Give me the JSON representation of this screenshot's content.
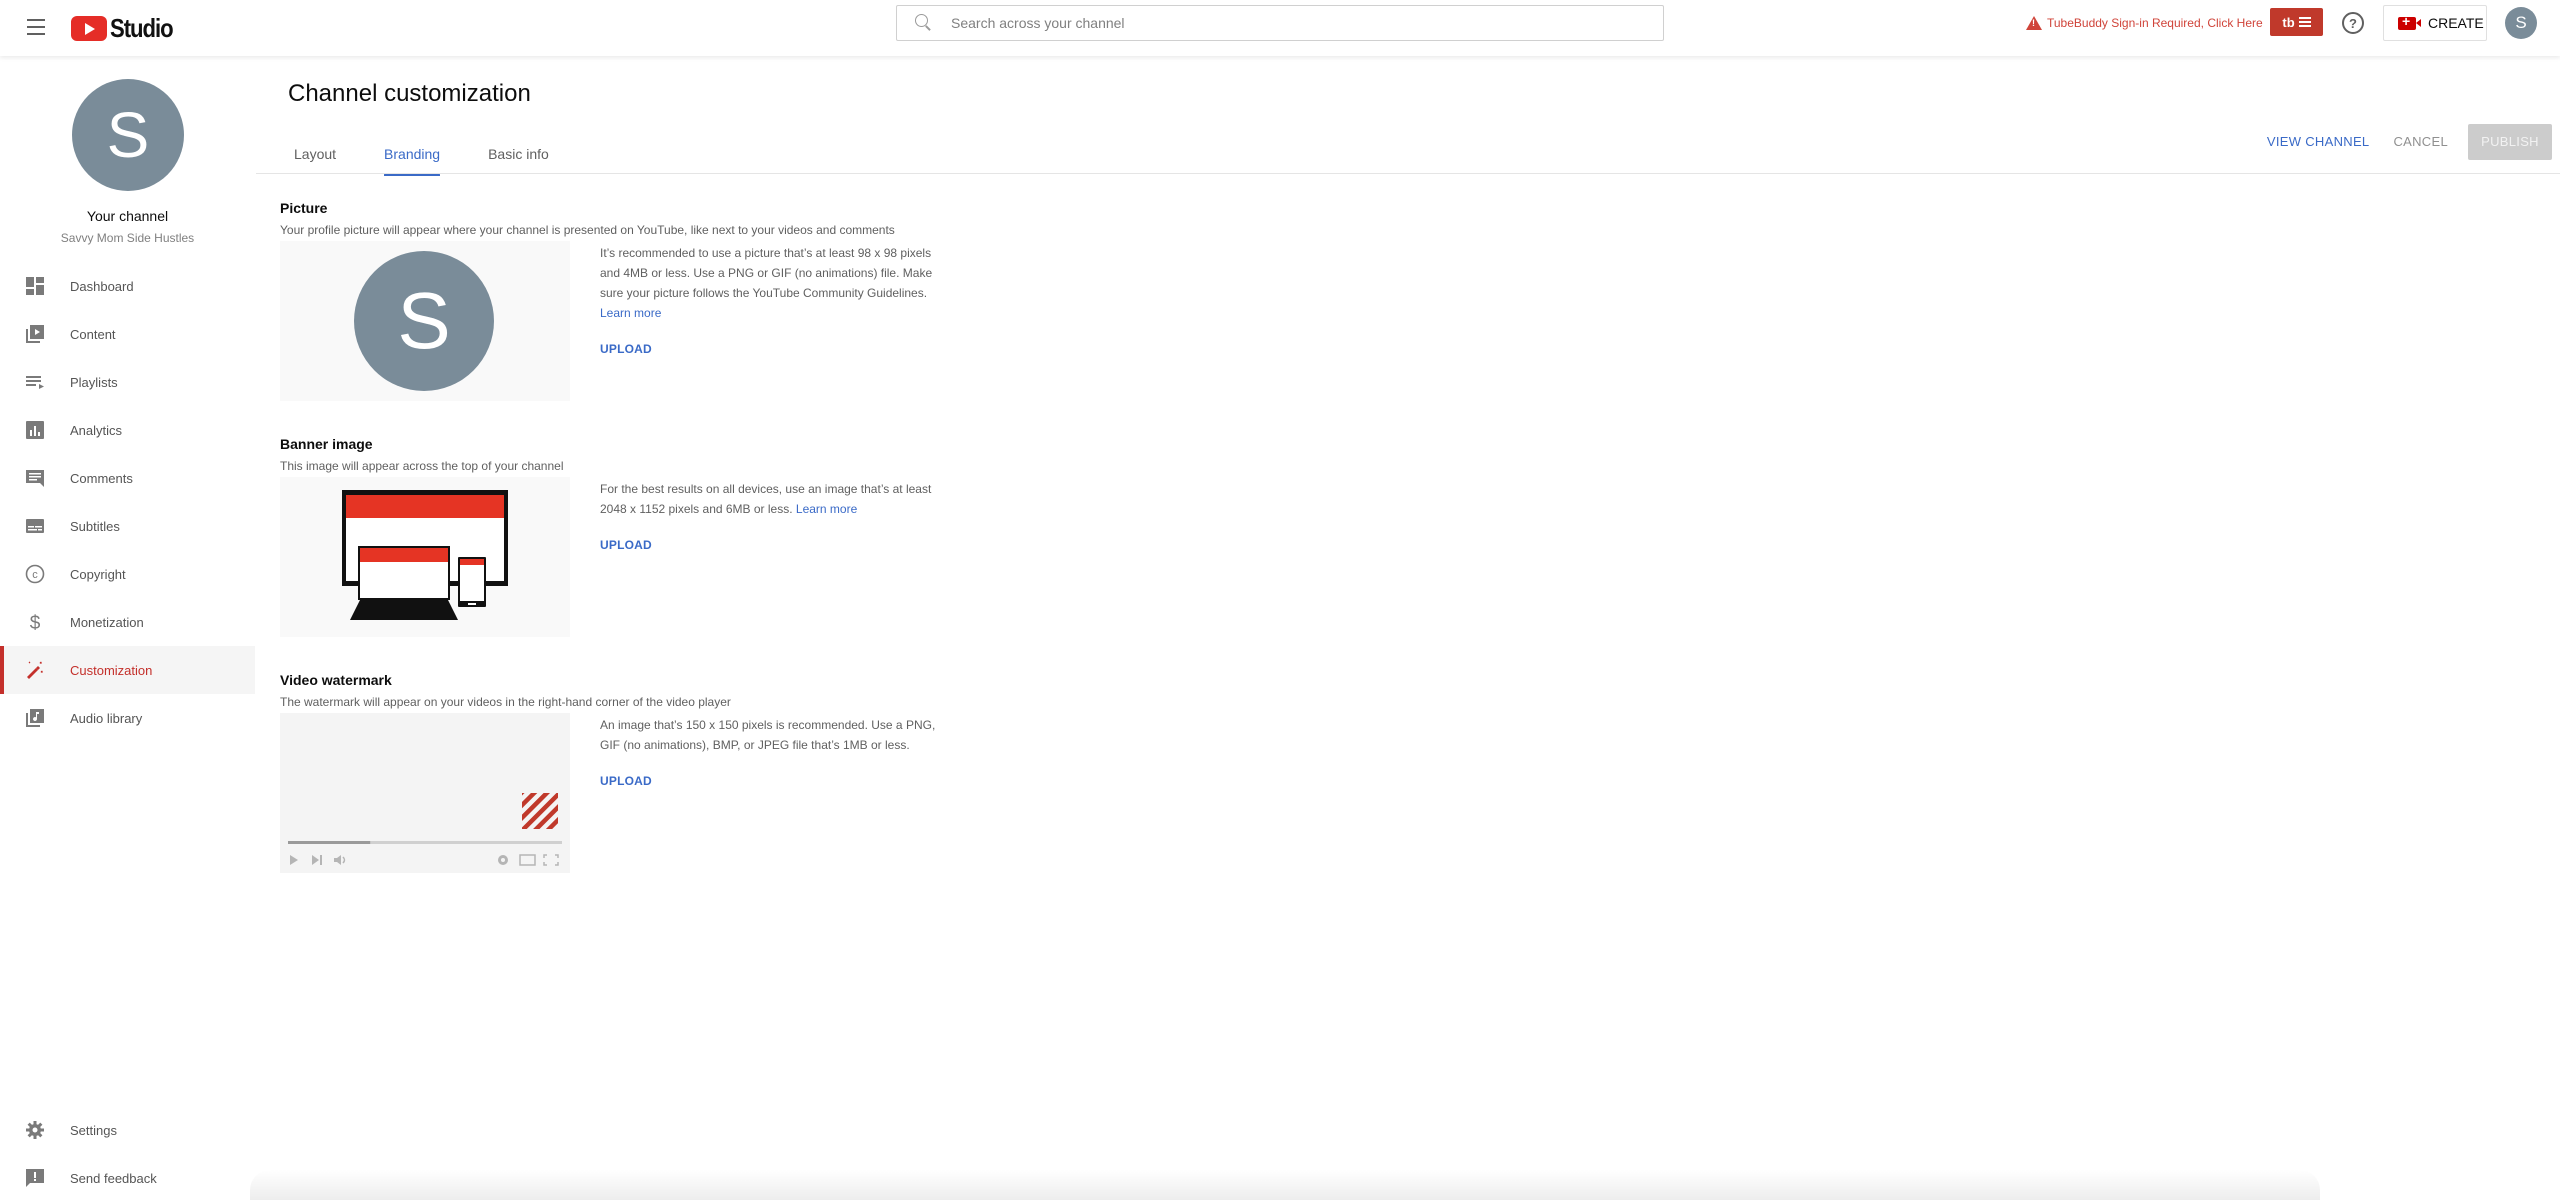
{
  "header": {
    "app_name": "Studio",
    "search_placeholder": "Search across your channel",
    "tubebuddy_warning": "TubeBuddy Sign-in Required, Click Here",
    "tubebuddy_button": "tb",
    "help_label": "?",
    "create_label": "CREATE",
    "avatar_letter": "S"
  },
  "sidebar": {
    "avatar_letter": "S",
    "channel_title": "Your channel",
    "channel_name": "Savvy Mom Side Hustles",
    "items": [
      {
        "label": "Dashboard",
        "icon": "dashboard-icon"
      },
      {
        "label": "Content",
        "icon": "content-icon"
      },
      {
        "label": "Playlists",
        "icon": "playlists-icon"
      },
      {
        "label": "Analytics",
        "icon": "analytics-icon"
      },
      {
        "label": "Comments",
        "icon": "comments-icon"
      },
      {
        "label": "Subtitles",
        "icon": "subtitles-icon"
      },
      {
        "label": "Copyright",
        "icon": "copyright-icon"
      },
      {
        "label": "Monetization",
        "icon": "monetization-icon"
      },
      {
        "label": "Customization",
        "icon": "customization-icon",
        "active": true
      },
      {
        "label": "Audio library",
        "icon": "audio-library-icon"
      }
    ],
    "bottom_items": [
      {
        "label": "Settings",
        "icon": "settings-icon"
      },
      {
        "label": "Send feedback",
        "icon": "feedback-icon"
      }
    ]
  },
  "main": {
    "title": "Channel customization",
    "tabs": [
      {
        "label": "Layout"
      },
      {
        "label": "Branding",
        "active": true
      },
      {
        "label": "Basic info"
      }
    ],
    "actions": {
      "view_channel": "VIEW CHANNEL",
      "cancel": "CANCEL",
      "publish": "PUBLISH"
    },
    "sections": {
      "picture": {
        "title": "Picture",
        "description": "Your profile picture will appear where your channel is presented on YouTube, like next to your videos and comments",
        "avatar_letter": "S",
        "info": "It’s recommended to use a picture that’s at least 98 x 98 pixels and 4MB or less. Use a PNG or GIF (no animations) file. Make sure your picture follows the YouTube Community Guidelines.",
        "learn_more": "Learn more",
        "upload": "UPLOAD"
      },
      "banner": {
        "title": "Banner image",
        "description": "This image will appear across the top of your channel",
        "info": "For the best results on all devices, use an image that’s at least 2048 x 1152 pixels and 6MB or less.",
        "learn_more": "Learn more",
        "upload": "UPLOAD"
      },
      "watermark": {
        "title": "Video watermark",
        "description": "The watermark will appear on your videos in the right-hand corner of the video player",
        "info": "An image that’s 150 x 150 pixels is recommended. Use a PNG, GIF (no animations), BMP, or JPEG file that’s 1MB or less.",
        "upload": "UPLOAD",
        "preview_progress_fraction": 0.3
      }
    }
  },
  "colors": {
    "accent_blue": "#3a6ac7",
    "active_red": "#c4302b",
    "avatar_gray": "#7a8c99",
    "youtube_red": "#e52d27"
  }
}
